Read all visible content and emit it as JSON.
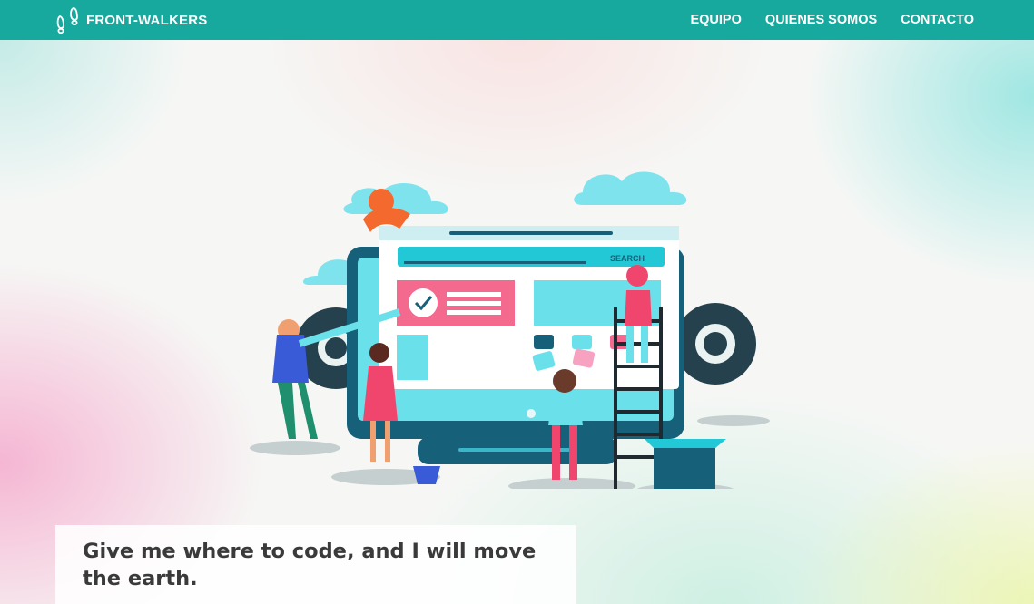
{
  "navbar": {
    "brand_icon": "footprints-icon",
    "brand": "FRONT-WALKERS",
    "links": [
      {
        "label": "EQUIPO"
      },
      {
        "label": "QUIENES SOMOS"
      },
      {
        "label": "CONTACTO"
      }
    ],
    "background": "#17a99d"
  },
  "hero": {
    "illustration": {
      "icon": "web-development-team-illustration",
      "search_label": "SEARCH"
    },
    "quote": "Give me where to code, and I will move the earth."
  }
}
